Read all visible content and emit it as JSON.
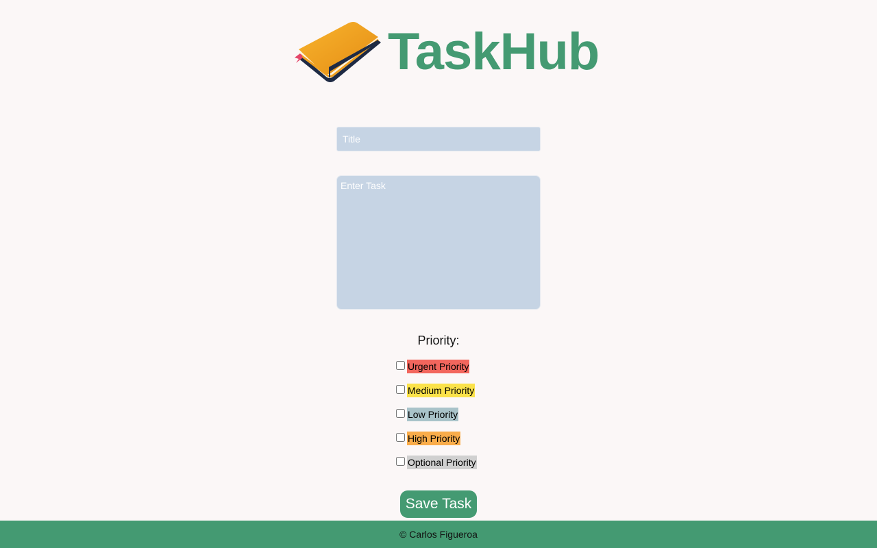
{
  "header": {
    "app_name": "TaskHub",
    "logo_icon": "book-icon",
    "brand_color": "#449a72"
  },
  "form": {
    "title_placeholder": "Title",
    "task_placeholder": "Enter Task",
    "priority_heading": "Priority:",
    "priorities": [
      {
        "label": "Urgent Priority",
        "color": "#f2665d",
        "checked": false
      },
      {
        "label": "Medium Priority",
        "color": "#fbe24a",
        "checked": false
      },
      {
        "label": "Low Priority",
        "color": "#a9c3c9",
        "checked": false
      },
      {
        "label": "High Priority",
        "color": "#f9ac4a",
        "checked": false
      },
      {
        "label": "Optional Priority",
        "color": "#d0d0d0",
        "checked": false
      }
    ],
    "save_label": "Save Task"
  },
  "footer": {
    "text": "© Carlos Figueroa"
  },
  "colors": {
    "background": "#fbf7f7",
    "input_fill": "#c6d4e4",
    "accent": "#449a72"
  }
}
